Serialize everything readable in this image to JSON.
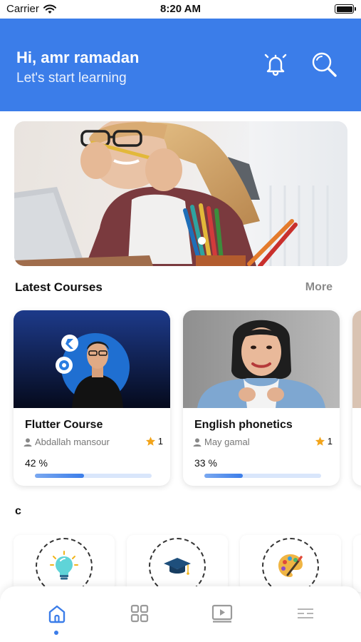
{
  "status_bar": {
    "carrier": "Carrier",
    "time": "8:20 AM"
  },
  "header": {
    "greeting": "Hi, amr ramadan",
    "subtitle": "Let's start learning",
    "bell_icon": "bell-icon",
    "search_icon": "search-icon"
  },
  "banner": {
    "image": "student-with-pencils-photo",
    "active_dot_index": 0
  },
  "latest_courses": {
    "title": "Latest Courses",
    "more_label": "More",
    "courses": [
      {
        "title": "Flutter Course",
        "author": "Abdallah mansour",
        "rating": "1",
        "progress_label": "42 %",
        "progress": 0.42
      },
      {
        "title": "English phonetics",
        "author": "May gamal",
        "rating": "1",
        "progress_label": "33 %",
        "progress": 0.33
      }
    ]
  },
  "categories": {
    "title": "c",
    "items": [
      {
        "icon": "lightbulb-icon"
      },
      {
        "icon": "graduation-cap-icon"
      },
      {
        "icon": "palette-icon"
      }
    ]
  },
  "bottom_nav": {
    "items": [
      {
        "icon": "home-icon",
        "active": true
      },
      {
        "icon": "grid-icon",
        "active": false
      },
      {
        "icon": "video-icon",
        "active": false
      },
      {
        "icon": "menu-lines-icon",
        "active": false
      }
    ]
  },
  "colors": {
    "primary": "#3b7de9",
    "star": "#f2a41a",
    "muted_text": "#8a8a8a"
  }
}
